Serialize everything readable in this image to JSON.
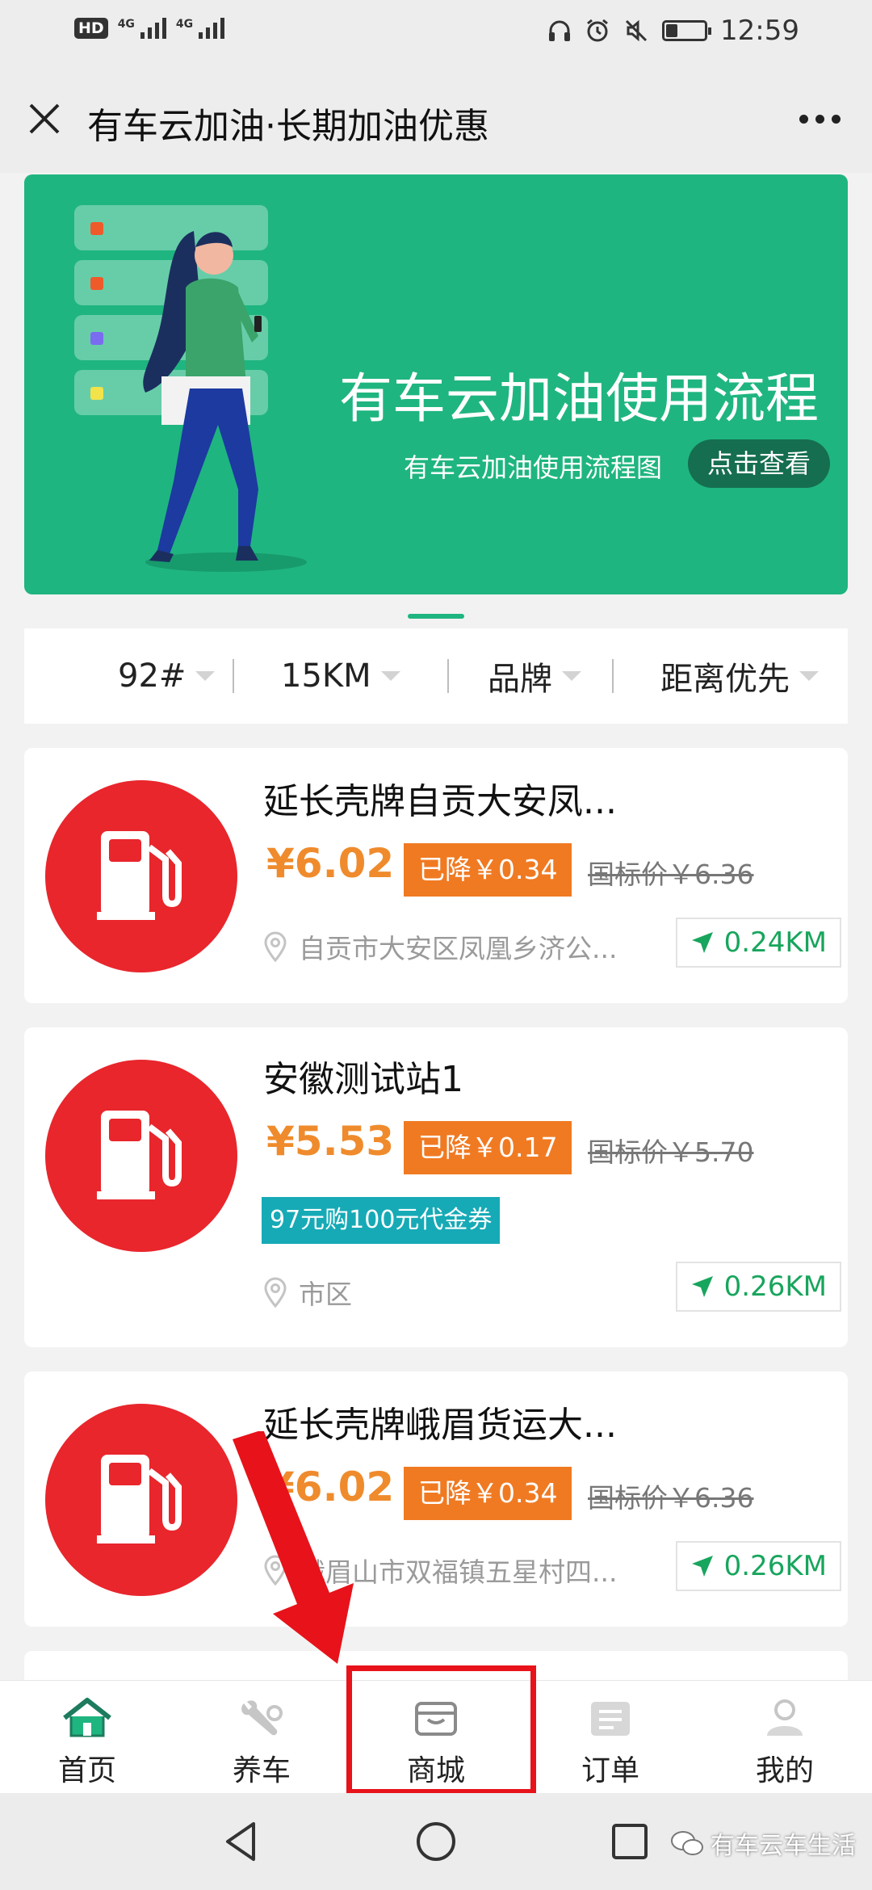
{
  "status_bar": {
    "hd": "HD",
    "net1": "4G",
    "net2": "4G",
    "battery_level": 0.3,
    "time": "12:59"
  },
  "header": {
    "title": "有车云加油·长期加油优惠",
    "close_icon": "close-icon",
    "more_icon": "more-icon"
  },
  "banner": {
    "title": "有车云加油使用流程",
    "subtitle": "有车云加油使用流程图",
    "button": "点击查看",
    "bg_color": "#1fb580"
  },
  "filters": [
    {
      "label": "92#"
    },
    {
      "label": "15KM"
    },
    {
      "label": "品牌"
    },
    {
      "label": "距离优先"
    }
  ],
  "stations": [
    {
      "name": "延长壳牌自贡大安凤...",
      "price": "¥6.02",
      "cut": "已降￥0.34",
      "ref_price": "国标价￥6.36",
      "coupon": "",
      "address": "自贡市大安区凤凰乡济公...",
      "distance": "0.24KM"
    },
    {
      "name": "安徽测试站1",
      "price": "¥5.53",
      "cut": "已降￥0.17",
      "ref_price": "国标价￥5.70",
      "coupon": "97元购100元代金券",
      "address": "市区",
      "distance": "0.26KM"
    },
    {
      "name": "延长壳牌峨眉货运大...",
      "price": "¥6.02",
      "cut": "已降￥0.34",
      "ref_price": "国标价￥6.36",
      "coupon": "",
      "address": "峨眉山市双福镇五星村四...",
      "distance": "0.26KM"
    }
  ],
  "tabs": [
    {
      "label": "首页",
      "icon": "home-icon",
      "active": true
    },
    {
      "label": "养车",
      "icon": "wrench-icon",
      "active": false
    },
    {
      "label": "商城",
      "icon": "shop-icon",
      "active": false
    },
    {
      "label": "订单",
      "icon": "order-icon",
      "active": false
    },
    {
      "label": "我的",
      "icon": "user-icon",
      "active": false
    }
  ],
  "watermark": "有车云车生活",
  "colors": {
    "accent_green": "#1fb580",
    "price_orange": "#ef8b2c",
    "badge_orange": "#f07a22",
    "pump_red": "#e8262c",
    "coupon_teal": "#16aab6",
    "annotation_red": "#e8121a"
  }
}
